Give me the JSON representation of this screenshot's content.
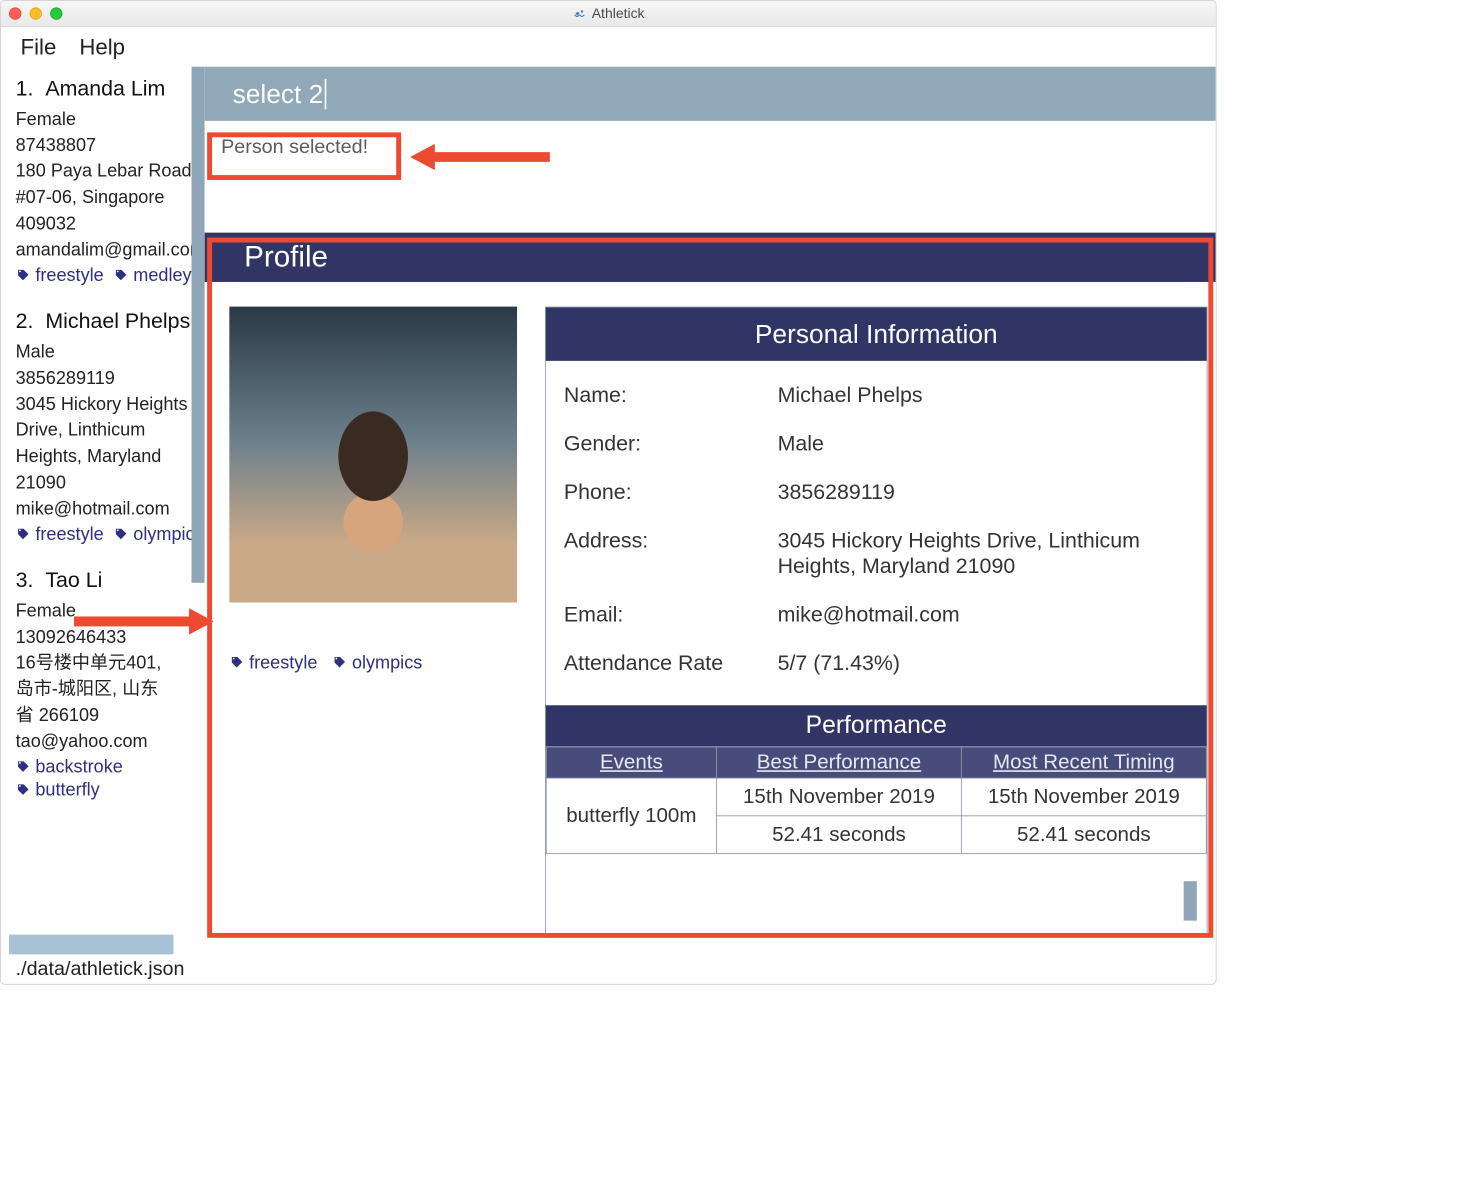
{
  "app": {
    "title": "Athletick"
  },
  "menu": {
    "file": "File",
    "help": "Help"
  },
  "command": {
    "input": "select 2",
    "result": "Person selected!"
  },
  "status": {
    "path": "./data/athletick.json"
  },
  "sidebar": {
    "people": [
      {
        "index": "1.",
        "name": "Amanda Lim",
        "gender": "Female",
        "phone": "87438807",
        "addr1": "180 Paya Lebar Road",
        "addr2": "#07-06, Singapore",
        "addr3": "409032",
        "email": "amandalim@gmail.com",
        "tags": [
          "freestyle",
          "medley"
        ]
      },
      {
        "index": "2.",
        "name": "Michael Phelps",
        "gender": "Male",
        "phone": "3856289119",
        "addr1": "3045 Hickory Heights",
        "addr2": "Drive, Linthicum",
        "addr3": "Heights, Maryland",
        "addr4": "21090",
        "email": "mike@hotmail.com",
        "tags": [
          "freestyle",
          "olympics"
        ]
      },
      {
        "index": "3.",
        "name": "Tao Li",
        "gender": "Female",
        "phone": "13092646433",
        "addr1": "16号楼中单元401,",
        "addr2": "岛市-城阳区, 山东",
        "addr3": "省 266109",
        "email": "tao@yahoo.com",
        "tags": [
          "backstroke",
          "butterfly"
        ]
      }
    ]
  },
  "profile": {
    "title": "Profile",
    "pi_title": "Personal Information",
    "labels": {
      "name": "Name:",
      "gender": "Gender:",
      "phone": "Phone:",
      "address": "Address:",
      "email": "Email:",
      "attendance": "Attendance Rate"
    },
    "values": {
      "name": "Michael Phelps",
      "gender": "Male",
      "phone": "3856289119",
      "address": "3045 Hickory Heights Drive, Linthicum Heights, Maryland 21090",
      "email": "mike@hotmail.com",
      "attendance": "5/7 (71.43%)"
    },
    "tags": [
      "freestyle",
      "olympics"
    ],
    "performance": {
      "title": "Performance",
      "headers": {
        "events": "Events",
        "best": "Best Performance",
        "recent": "Most Recent Timing"
      },
      "rows": [
        {
          "event": "butterfly 100m",
          "best_date": "15th November 2019",
          "best_time": "52.41 seconds",
          "recent_date": "15th November 2019",
          "recent_time": "52.41 seconds"
        }
      ]
    }
  }
}
